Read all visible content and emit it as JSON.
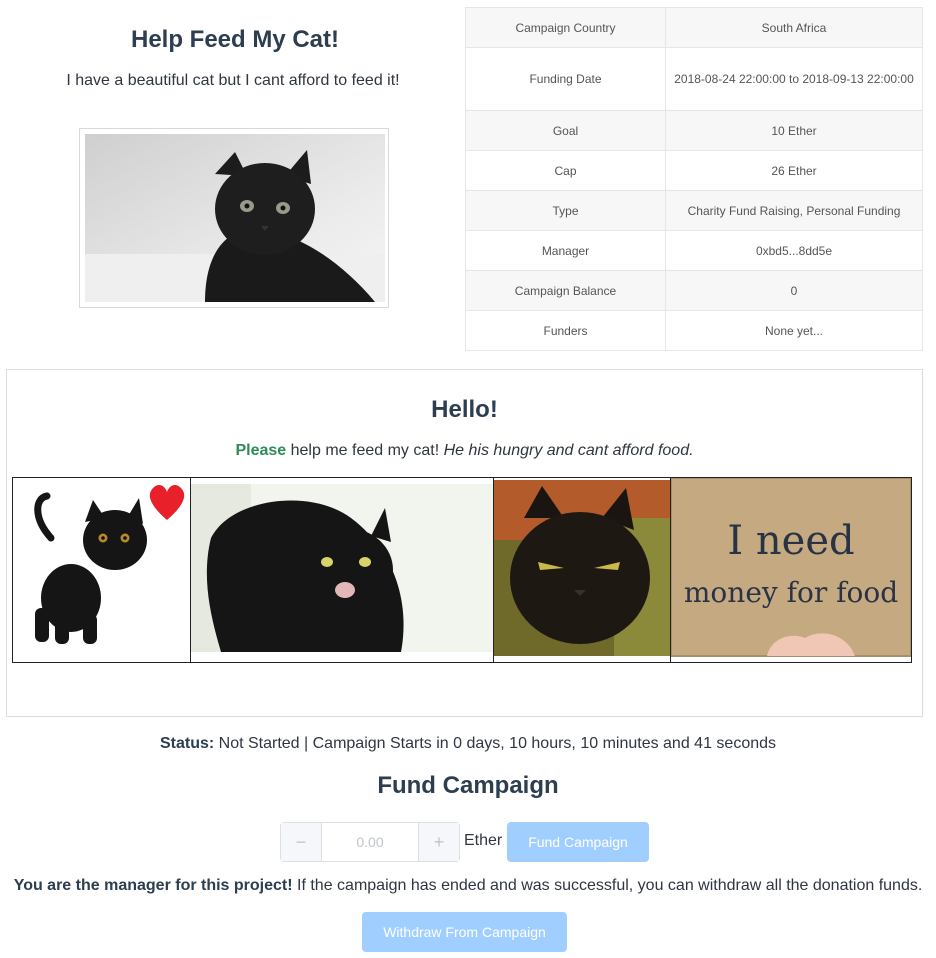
{
  "campaign": {
    "title": "Help Feed My Cat!",
    "description": "I have a beautiful cat but I cant afford to feed it!"
  },
  "details": [
    {
      "label": "Campaign Country",
      "value": "South Africa"
    },
    {
      "label": "Funding Date",
      "value": "2018-08-24 22:00:00 to 2018-09-13 22:00:00"
    },
    {
      "label": "Goal",
      "value": "10 Ether"
    },
    {
      "label": "Cap",
      "value": "26 Ether"
    },
    {
      "label": "Type",
      "value": "Charity Fund Raising, Personal Funding"
    },
    {
      "label": "Manager",
      "value": "0xbd5...8dd5e"
    },
    {
      "label": "Campaign Balance",
      "value": "0"
    },
    {
      "label": "Funders",
      "value": "None yet..."
    }
  ],
  "panel": {
    "heading": "Hello!",
    "please": "Please",
    "line_plain": " help me feed my cat! ",
    "line_italic": "He his hungry and cant afford food."
  },
  "sign": {
    "line1": "I need",
    "line2": "money for food"
  },
  "status": {
    "label": "Status:",
    "text": " Not Started | Campaign Starts in 0 days, 10 hours, 10 minutes and 41 seconds"
  },
  "fund": {
    "heading": "Fund Campaign",
    "amount_placeholder": "0.00",
    "unit": "Ether",
    "button": "Fund Campaign",
    "minus": "−",
    "plus": "+"
  },
  "manager": {
    "bold": "You are the manager for this project!",
    "text": " If the campaign has ended and was successful, you can withdraw all the donation funds.",
    "withdraw_button": "Withdraw From Campaign"
  },
  "colors": {
    "accent_green": "#2e8b57",
    "button_disabled": "#a0cfff",
    "heading": "#2c3e50"
  }
}
